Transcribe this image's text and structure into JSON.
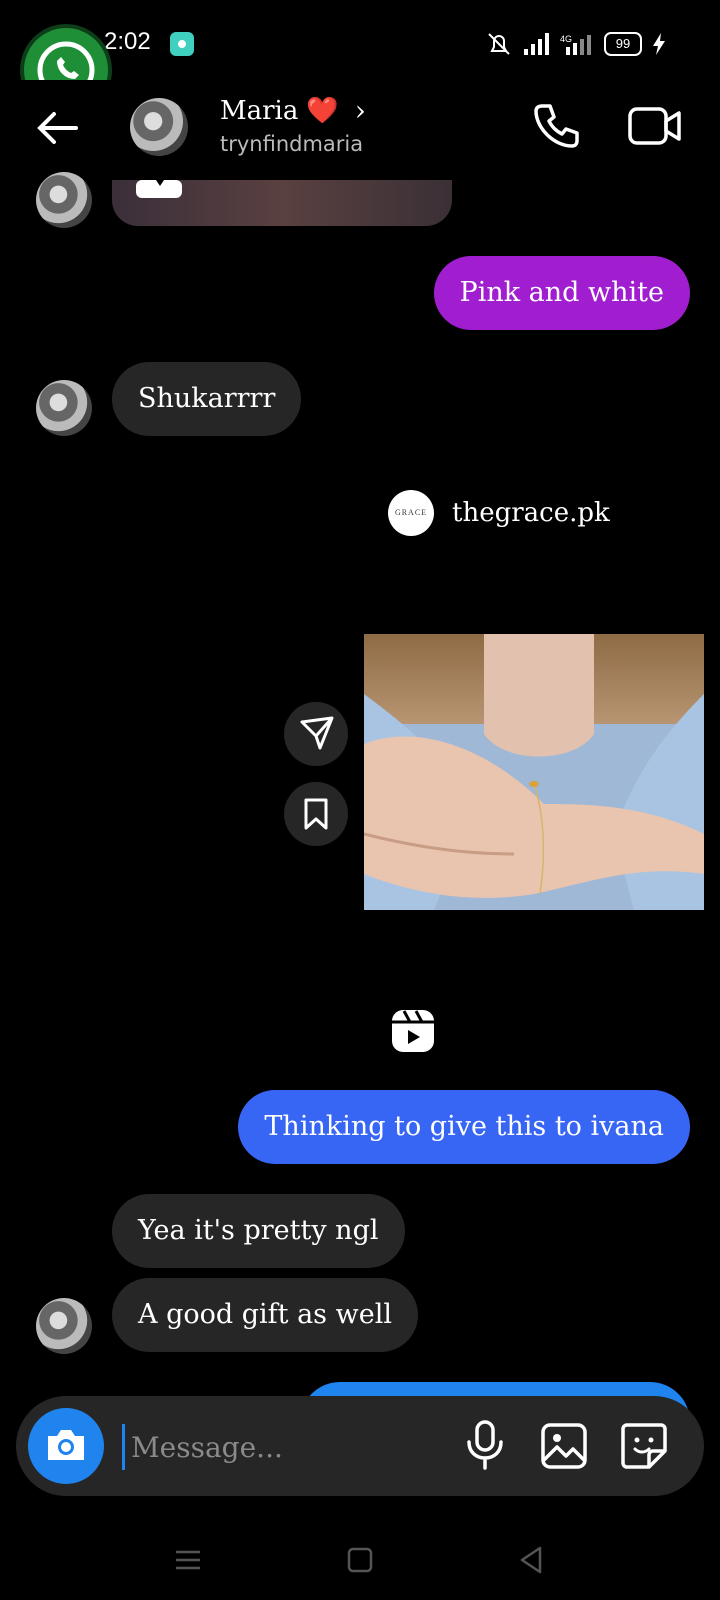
{
  "status_bar": {
    "time": "2:02",
    "battery": "99"
  },
  "header": {
    "contact_name": "Maria",
    "name_emoji": "❤️",
    "chevron": "›",
    "username": "trynfindmaria"
  },
  "messages": {
    "pink_and_white": "Pink and white",
    "shukarrrr": "Shukarrrr",
    "thinking": "Thinking to give this to ivana",
    "yea_pretty": "Yea it's pretty ngl",
    "good_gift": "A good gift as well"
  },
  "shared_post": {
    "account": "thegrace.pk",
    "logo_text": "GRACE"
  },
  "composer": {
    "placeholder": "Message..."
  },
  "colors": {
    "purple_bubble": "#a11ed0",
    "blue_bubble": "#3766f4",
    "accent": "#1f84ee",
    "incoming_bubble": "#262626"
  },
  "icons": [
    "whatsapp-icon",
    "back-arrow-icon",
    "phone-icon",
    "video-camera-icon",
    "send-icon",
    "bookmark-icon",
    "reels-icon",
    "camera-icon",
    "microphone-icon",
    "gallery-icon",
    "sticker-icon"
  ]
}
